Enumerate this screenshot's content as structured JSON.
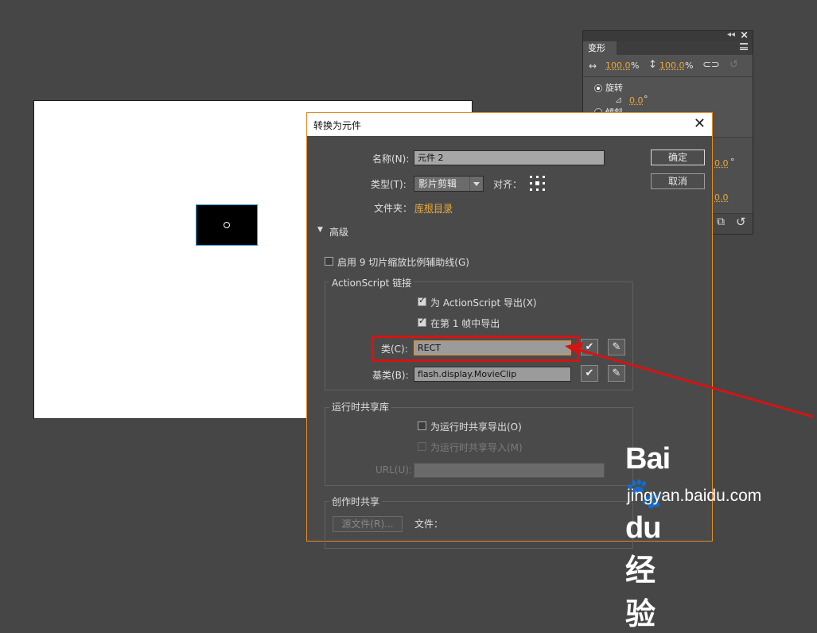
{
  "stage": {},
  "transform_panel": {
    "tab_label": "变形",
    "width_value": "100.0",
    "height_value": "100.0",
    "percent": "%",
    "rotate_label": "旋转",
    "rotate_value": "0.0",
    "degree": "°",
    "skew_label": "倾斜",
    "skew_value": "0.0",
    "skew_value2": "0.0"
  },
  "dialog": {
    "title": "转换为元件",
    "name_label": "名称(N):",
    "name_value": "元件 2",
    "ok_button": "确定",
    "cancel_button": "取消",
    "type_label": "类型(T):",
    "type_value": "影片剪辑",
    "align_label": "对齐：",
    "folder_label": "文件夹：",
    "folder_value": "库根目录",
    "advanced_label": "高级",
    "nine_slice_label": "启用 9 切片缩放比例辅助线(G)",
    "as_group_title": "ActionScript 链接",
    "export_as_label": "为 ActionScript 导出(X)",
    "export_frame_label": "在第 1 帧中导出",
    "class_label": "类(C):",
    "class_value": "RECT",
    "base_class_label": "基类(B):",
    "base_class_value": "flash.display.MovieClip",
    "runtime_group_title": "运行时共享库",
    "runtime_export_label": "为运行时共享导出(O)",
    "runtime_import_label": "为运行时共享导入(M)",
    "url_label": "URL(U):",
    "authoring_group_title": "创作时共享",
    "source_file_button": "源文件(R)...",
    "file_label": "文件："
  },
  "watermark": {
    "brand": "Bai🐾du 经验",
    "url": "jingyan.baidu.com"
  },
  "colors": {
    "accent": "#e28a2b",
    "annotation_red": "#d41414"
  }
}
